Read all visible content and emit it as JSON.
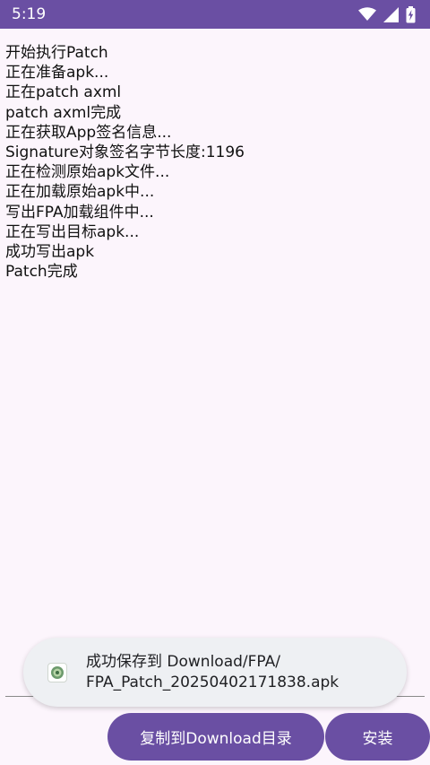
{
  "status_bar": {
    "time": "5:19",
    "icons": [
      "wifi-icon",
      "signal-icon",
      "battery-charging-icon"
    ],
    "color": "#6a4fa3"
  },
  "log": {
    "lines": [
      "开始执行Patch",
      "正在准备apk...",
      "正在patch axml",
      "patch axml完成",
      "正在获取App签名信息...",
      "Signature对象签名字节长度:1196",
      "正在检测原始apk文件...",
      "正在加载原始apk中...",
      "写出FPA加载组件中...",
      "正在写出目标apk...",
      "成功写出apk",
      "Patch完成"
    ]
  },
  "toast": {
    "line1": "成功保存到 Download/FPA/",
    "line2": "FPA_Patch_20250402171838.apk",
    "icon": "app-icon"
  },
  "buttons": {
    "copy_label": "复制到Download目录",
    "install_label": "安装",
    "color": "#6a4fa3"
  }
}
